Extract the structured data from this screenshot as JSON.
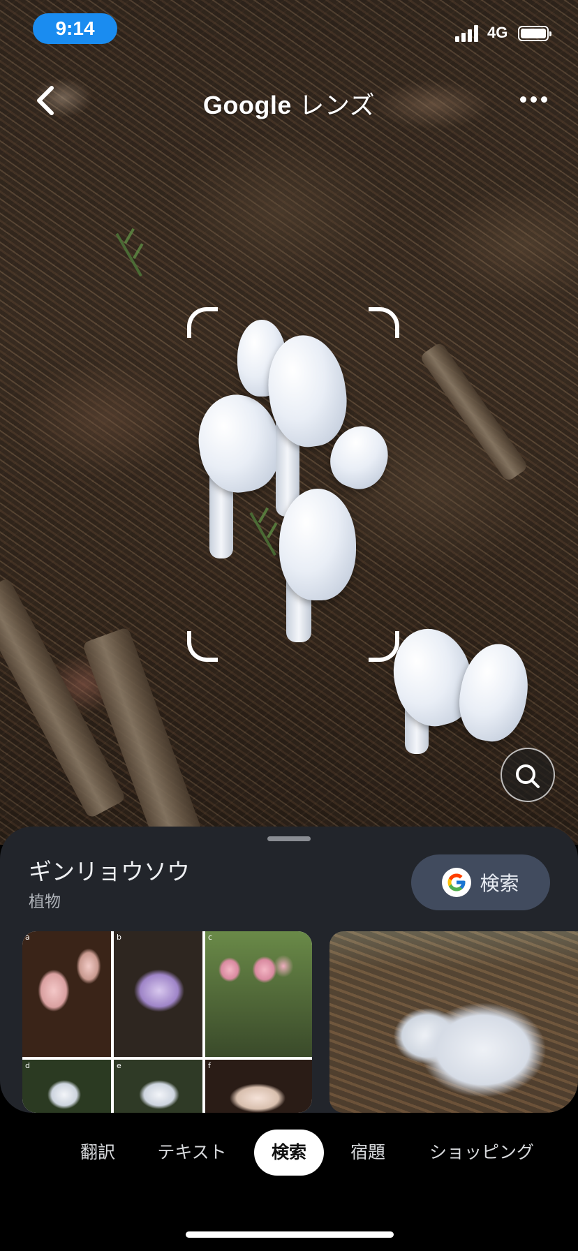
{
  "status_bar": {
    "time": "9:14",
    "network": "4G"
  },
  "header": {
    "title_brand": "Google",
    "title_product": "レンズ"
  },
  "icons": {
    "back": "chevron-left-icon",
    "more": "more-horizontal-icon",
    "lens_search": "lens-search-icon",
    "google": "google-g-icon"
  },
  "result": {
    "title": "ギンリョウソウ",
    "subtitle": "植物",
    "search_button_label": "検索"
  },
  "thumbnail_grid_labels": [
    "a",
    "b",
    "c",
    "d",
    "e",
    "f"
  ],
  "tabs": [
    {
      "label": "翻訳"
    },
    {
      "label": "テキスト"
    },
    {
      "label": "検索",
      "active": true
    },
    {
      "label": "宿題"
    },
    {
      "label": "ショッピング"
    }
  ],
  "colors": {
    "time_pill": "#1a8cf0",
    "sheet_background": "#22252b",
    "search_button_background": "#414b5e",
    "active_tab_background": "#ffffff"
  }
}
